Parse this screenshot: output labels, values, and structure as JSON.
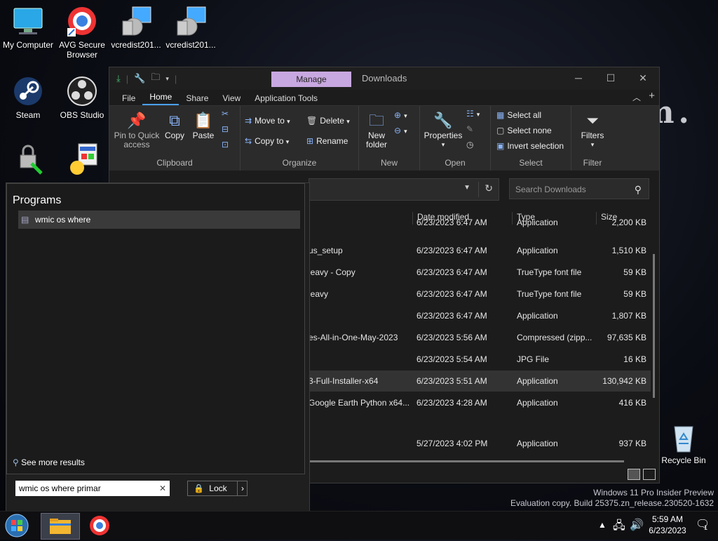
{
  "desktop": {
    "icons": [
      {
        "label": "My Computer"
      },
      {
        "label": "AVG Secure Browser"
      },
      {
        "label": "vcredist201..."
      },
      {
        "label": "vcredist201..."
      },
      {
        "label": "Steam"
      },
      {
        "label": "OBS Studio"
      },
      {
        "label": "Recycle Bin"
      }
    ],
    "watermark_line1": "Windows 11 Pro Insider Preview",
    "watermark_line2": "Evaluation copy. Build 25375.zn_release.230520-1632"
  },
  "explorer": {
    "title": "Downloads",
    "manage_tab": "Manage",
    "tabs": [
      "File",
      "Home",
      "Share",
      "View",
      "Application Tools"
    ],
    "active_tab": "Home",
    "ribbon": {
      "clipboard": {
        "label": "Clipboard",
        "pin": "Pin to Quick access",
        "copy": "Copy",
        "paste": "Paste"
      },
      "organize": {
        "label": "Organize",
        "move_to": "Move to",
        "copy_to": "Copy to",
        "delete": "Delete",
        "rename": "Rename"
      },
      "new": {
        "label": "New",
        "new_folder": "New folder"
      },
      "open": {
        "label": "Open",
        "properties": "Properties"
      },
      "select": {
        "label": "Select",
        "select_all": "Select all",
        "select_none": "Select none",
        "invert": "Invert selection"
      },
      "filter": {
        "label": "Filter",
        "filters": "Filters"
      }
    },
    "search_placeholder": "Search Downloads",
    "columns": [
      "Date modified",
      "Type",
      "Size"
    ],
    "files": [
      {
        "name": "",
        "date": "6/23/2023 6:47 AM",
        "type": "Application",
        "size": "2,200 KB"
      },
      {
        "name": "us_setup",
        "date": "6/23/2023 6:47 AM",
        "type": "Application",
        "size": "1,510 KB"
      },
      {
        "name": "leavy - Copy",
        "date": "6/23/2023 6:47 AM",
        "type": "TrueType font file",
        "size": "59 KB"
      },
      {
        "name": "leavy",
        "date": "6/23/2023 6:47 AM",
        "type": "TrueType font file",
        "size": "59 KB"
      },
      {
        "name": "",
        "date": "6/23/2023 6:47 AM",
        "type": "Application",
        "size": "1,807 KB"
      },
      {
        "name": "es-All-in-One-May-2023",
        "date": "6/23/2023 5:56 AM",
        "type": "Compressed (zipp...",
        "size": "97,635 KB"
      },
      {
        "name": "",
        "date": "6/23/2023 5:54 AM",
        "type": "JPG File",
        "size": "16 KB"
      },
      {
        "name": "3-Full-Installer-x64",
        "date": "6/23/2023 5:51 AM",
        "type": "Application",
        "size": "130,942 KB"
      },
      {
        "name": "Google Earth Python x64...",
        "date": "6/23/2023 4:28 AM",
        "type": "Application",
        "size": "416 KB"
      },
      {
        "name": "",
        "date": "5/27/2023 4:02 PM",
        "type": "Application",
        "size": "937 KB"
      }
    ]
  },
  "startmenu": {
    "section_title": "Programs",
    "result": "wmic os where",
    "see_more": "See more results",
    "search_value": "wmic os where primar",
    "lock_label": "Lock"
  },
  "taskbar": {
    "time": "5:59 AM",
    "date": "6/23/2023",
    "notification_count": "1"
  }
}
